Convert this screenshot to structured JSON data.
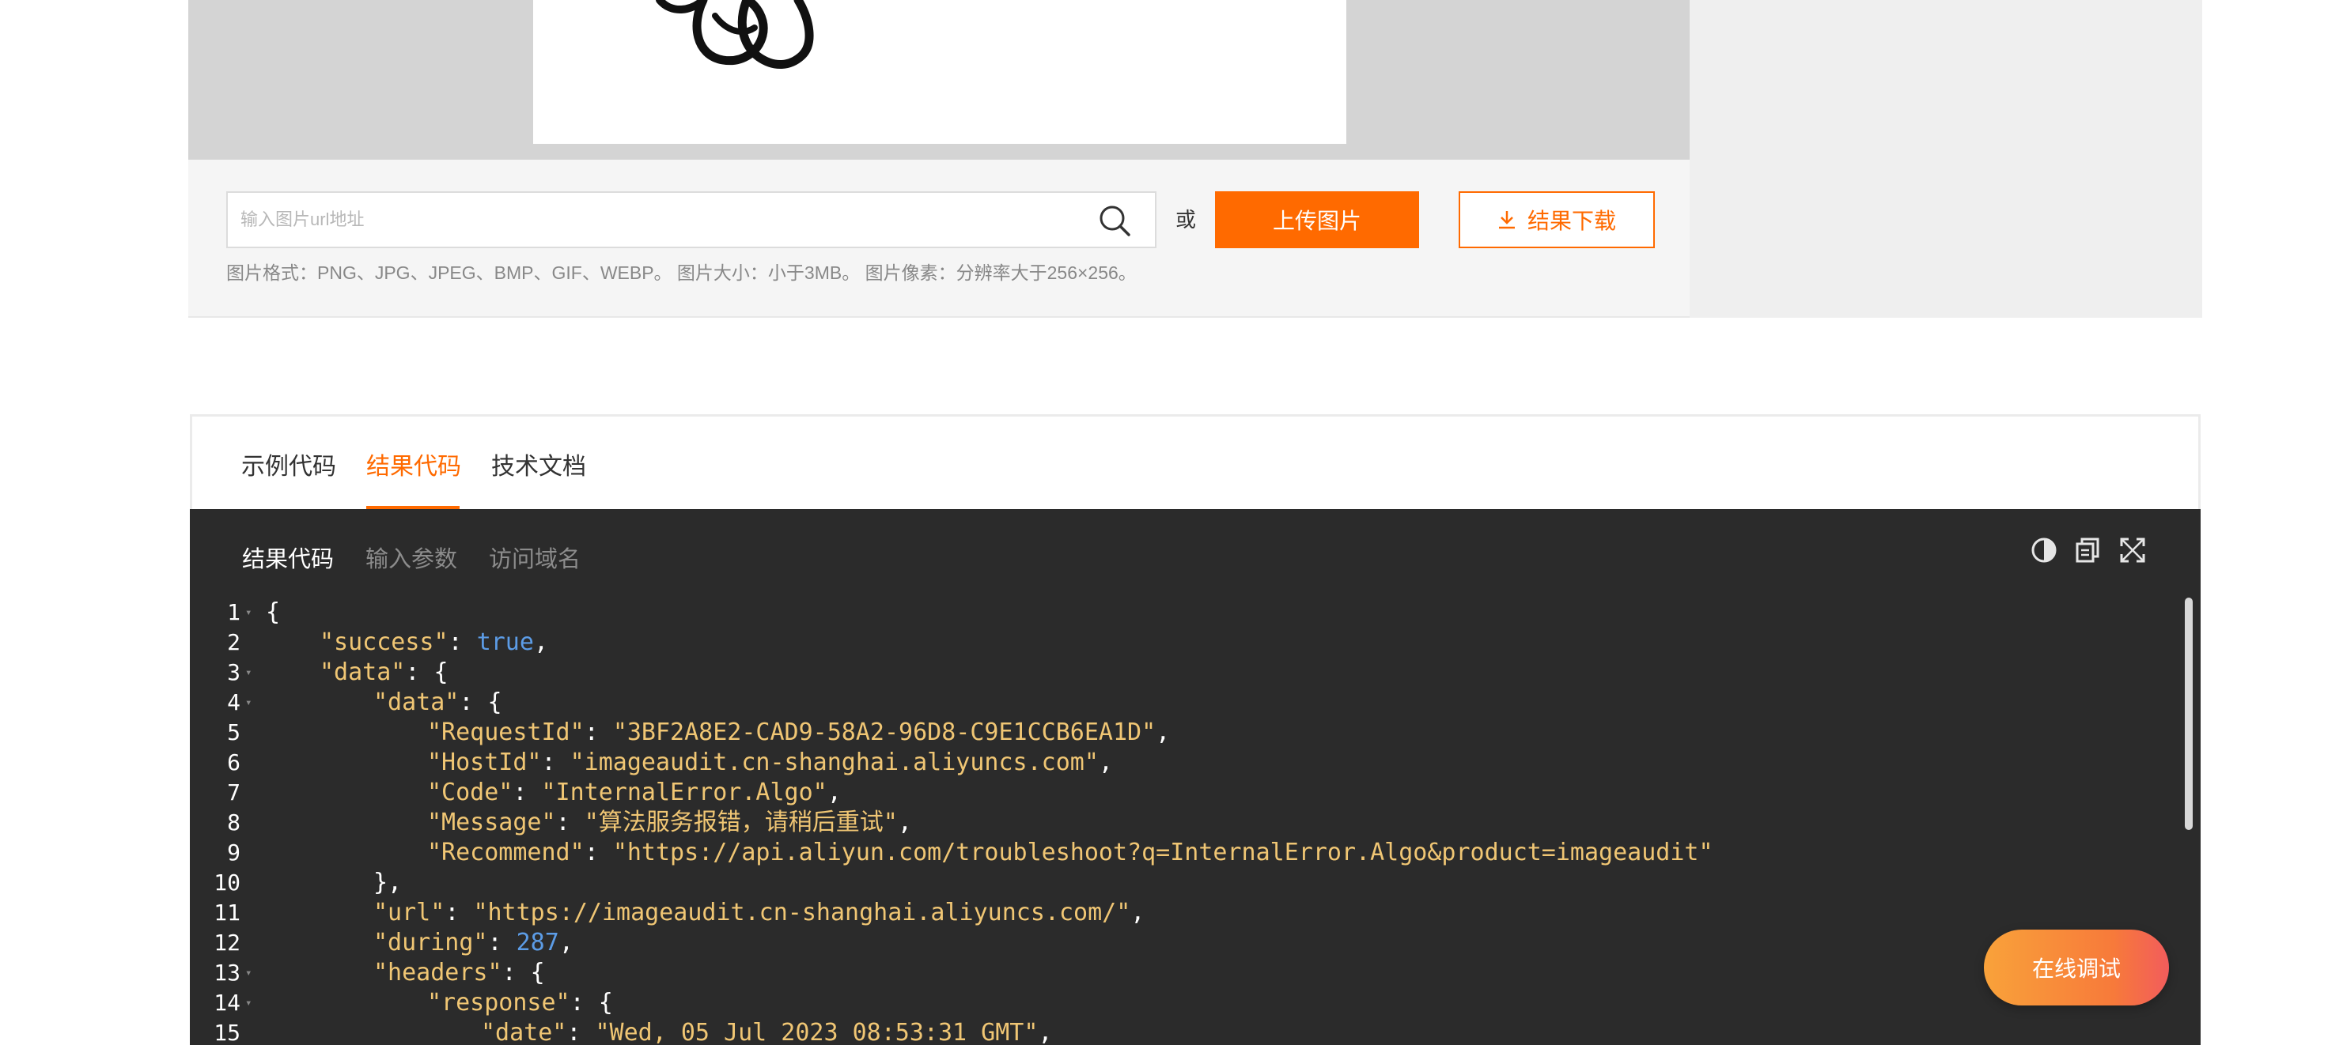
{
  "upload": {
    "url_placeholder": "输入图片url地址",
    "or_text": "或",
    "upload_button": "上传图片",
    "download_button": "结果下载",
    "hint": "图片格式：PNG、JPG、JPEG、BMP、GIF、WEBP。 图片大小：小于3MB。 图片像素：分辨率大于256×256。"
  },
  "tabs": [
    {
      "label": "示例代码",
      "active": false
    },
    {
      "label": "结果代码",
      "active": true
    },
    {
      "label": "技术文档",
      "active": false
    }
  ],
  "code_panel": {
    "tabs": [
      {
        "label": "结果代码",
        "active": true
      },
      {
        "label": "输入参数",
        "active": false
      },
      {
        "label": "访问域名",
        "active": false
      }
    ],
    "icons": [
      "contrast-icon",
      "copy-icon",
      "fullscreen-icon"
    ],
    "colors": {
      "background": "#2b2b2b",
      "key": "#f0c674",
      "boolean": "#5c9ce6"
    },
    "lines": [
      {
        "n": "1",
        "fold": true,
        "indent": 0,
        "parts": [
          [
            "p",
            "{"
          ]
        ]
      },
      {
        "n": "2",
        "fold": false,
        "indent": 1,
        "parts": [
          [
            "k",
            "\"success\""
          ],
          [
            "p",
            ": "
          ],
          [
            "b",
            "true"
          ],
          [
            "p",
            ","
          ]
        ]
      },
      {
        "n": "3",
        "fold": true,
        "indent": 1,
        "parts": [
          [
            "k",
            "\"data\""
          ],
          [
            "p",
            ": {"
          ]
        ]
      },
      {
        "n": "4",
        "fold": true,
        "indent": 2,
        "parts": [
          [
            "k",
            "\"data\""
          ],
          [
            "p",
            ": {"
          ]
        ]
      },
      {
        "n": "5",
        "fold": false,
        "indent": 3,
        "parts": [
          [
            "k",
            "\"RequestId\""
          ],
          [
            "p",
            ": "
          ],
          [
            "s",
            "\"3BF2A8E2-CAD9-58A2-96D8-C9E1CCB6EA1D\""
          ],
          [
            "p",
            ","
          ]
        ]
      },
      {
        "n": "6",
        "fold": false,
        "indent": 3,
        "parts": [
          [
            "k",
            "\"HostId\""
          ],
          [
            "p",
            ": "
          ],
          [
            "s",
            "\"imageaudit.cn-shanghai.aliyuncs.com\""
          ],
          [
            "p",
            ","
          ]
        ]
      },
      {
        "n": "7",
        "fold": false,
        "indent": 3,
        "parts": [
          [
            "k",
            "\"Code\""
          ],
          [
            "p",
            ": "
          ],
          [
            "s",
            "\"InternalError.Algo\""
          ],
          [
            "p",
            ","
          ]
        ]
      },
      {
        "n": "8",
        "fold": false,
        "indent": 3,
        "parts": [
          [
            "k",
            "\"Message\""
          ],
          [
            "p",
            ": "
          ],
          [
            "s",
            "\"算法服务报错，请稍后重试\""
          ],
          [
            "p",
            ","
          ]
        ]
      },
      {
        "n": "9",
        "fold": false,
        "indent": 3,
        "parts": [
          [
            "k",
            "\"Recommend\""
          ],
          [
            "p",
            ": "
          ],
          [
            "s",
            "\"https://api.aliyun.com/troubleshoot?q=InternalError.Algo&product=imageaudit\""
          ]
        ]
      },
      {
        "n": "10",
        "fold": false,
        "indent": 2,
        "parts": [
          [
            "p",
            "},"
          ]
        ]
      },
      {
        "n": "11",
        "fold": false,
        "indent": 2,
        "parts": [
          [
            "k",
            "\"url\""
          ],
          [
            "p",
            ": "
          ],
          [
            "s",
            "\"https://imageaudit.cn-shanghai.aliyuncs.com/\""
          ],
          [
            "p",
            ","
          ]
        ]
      },
      {
        "n": "12",
        "fold": false,
        "indent": 2,
        "parts": [
          [
            "k",
            "\"during\""
          ],
          [
            "p",
            ": "
          ],
          [
            "b",
            "287"
          ],
          [
            "p",
            ","
          ]
        ]
      },
      {
        "n": "13",
        "fold": true,
        "indent": 2,
        "parts": [
          [
            "k",
            "\"headers\""
          ],
          [
            "p",
            ": {"
          ]
        ]
      },
      {
        "n": "14",
        "fold": true,
        "indent": 3,
        "parts": [
          [
            "k",
            "\"response\""
          ],
          [
            "p",
            ": {"
          ]
        ]
      },
      {
        "n": "15",
        "fold": false,
        "indent": 4,
        "parts": [
          [
            "k",
            "\"date\""
          ],
          [
            "p",
            ": "
          ],
          [
            "s",
            "\"Wed, 05 Jul 2023 08:53:31 GMT\""
          ],
          [
            "p",
            ","
          ]
        ]
      }
    ]
  },
  "floating": {
    "debug_button": "在线调试"
  }
}
